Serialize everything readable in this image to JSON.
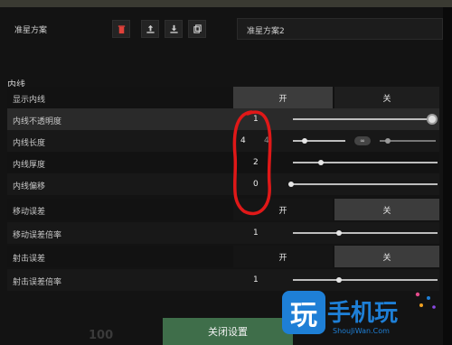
{
  "header": {
    "preset_label": "准星方案",
    "icons": [
      "trash-icon",
      "upload-icon",
      "download-icon",
      "copy-icon"
    ],
    "preset_value": "准星方案2"
  },
  "section": {
    "title": "内线"
  },
  "rows": {
    "show_inner": {
      "label": "显示内线",
      "on": "开",
      "off": "关"
    },
    "inner_opacity": {
      "label": "内线不透明度",
      "value": "1"
    },
    "inner_length": {
      "label": "内线长度",
      "value_a": "4",
      "value_b": "4",
      "link": "∞"
    },
    "inner_thickness": {
      "label": "内线厚度",
      "value": "2"
    },
    "inner_offset": {
      "label": "内线偏移",
      "value": "0"
    },
    "move_error": {
      "label": "移动误差",
      "on": "开",
      "off": "关"
    },
    "move_error_mult": {
      "label": "移动误差倍率",
      "value": "1"
    },
    "fire_error": {
      "label": "射击误差",
      "on": "开",
      "off": "关"
    },
    "fire_error_mult": {
      "label": "射击误差倍率",
      "value": "1"
    }
  },
  "footer": {
    "close_label": "关闭设置",
    "bg_number": "100"
  },
  "watermark": {
    "tile": "玩",
    "text": "手机玩",
    "sub": "ShouJiWan.Com"
  },
  "colors": {
    "accent_green": "#3f6e4a",
    "annotation_red": "#e01818",
    "watermark_blue": "#1e7fd6"
  }
}
